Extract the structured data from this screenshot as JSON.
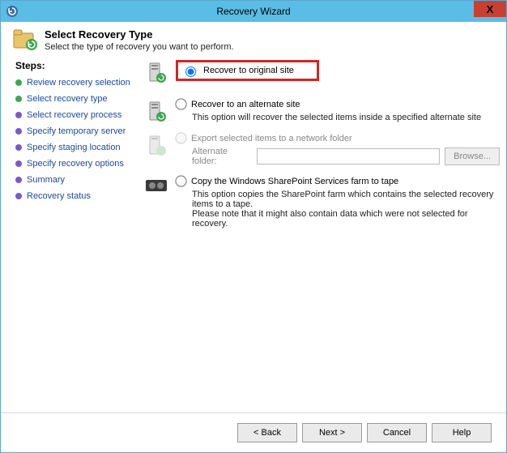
{
  "window": {
    "title": "Recovery Wizard",
    "close_glyph": "X"
  },
  "header": {
    "title": "Select Recovery Type",
    "subtitle": "Select the type of recovery you want to perform."
  },
  "steps": {
    "title": "Steps:",
    "items": [
      {
        "label": "Review recovery selection",
        "state": "done"
      },
      {
        "label": "Select recovery type",
        "state": "current"
      },
      {
        "label": "Select recovery process",
        "state": "pending"
      },
      {
        "label": "Specify temporary server",
        "state": "pending"
      },
      {
        "label": "Specify staging location",
        "state": "pending"
      },
      {
        "label": "Specify recovery options",
        "state": "pending"
      },
      {
        "label": "Summary",
        "state": "pending"
      },
      {
        "label": "Recovery status",
        "state": "pending"
      }
    ]
  },
  "options": {
    "original": {
      "label": "Recover to original site",
      "selected": true
    },
    "alternate": {
      "label": "Recover to an alternate site",
      "description": "This option will recover the selected items inside a specified alternate site"
    },
    "export": {
      "label": "Export selected items to a network folder",
      "alt_folder_label": "Alternate folder:",
      "browse_label": "Browse...",
      "enabled": false
    },
    "copy_tape": {
      "label": "Copy the Windows SharePoint Services farm to tape",
      "desc1": "This option copies the SharePoint farm which contains the selected recovery items to a tape.",
      "desc2": "Please note that it might also contain data which were not selected for recovery."
    }
  },
  "footer": {
    "back": "< Back",
    "next": "Next >",
    "cancel": "Cancel",
    "help": "Help"
  }
}
